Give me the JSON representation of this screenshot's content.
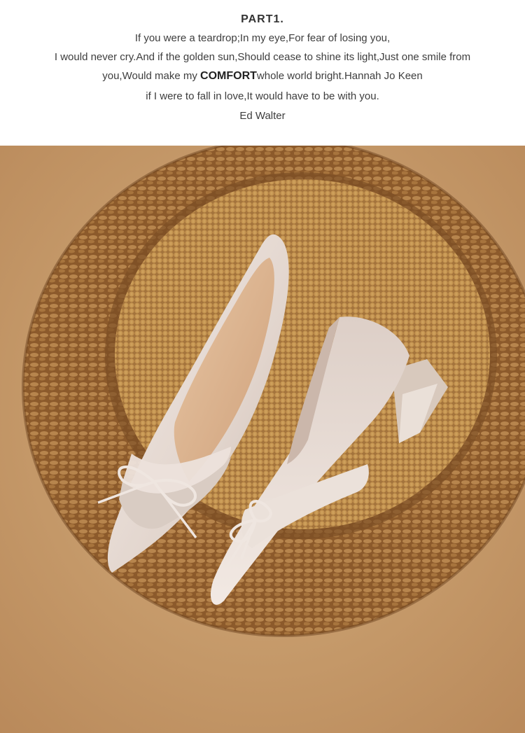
{
  "header": {
    "title": "PART1.",
    "line1": "If you were a teardrop;In my eye,For fear of losing you,",
    "line2": "I would never cry.And if the golden sun,Should cease to shine its light,Just one smile from",
    "line3_before": "you,Would make my ",
    "line3_emphasis": "COMFORT",
    "line3_after": "whole world bright.Hannah Jo Keen",
    "line4": "if I were to fall in love,It would have to be with you.",
    "line5": "Ed Walter"
  },
  "photo": {
    "subject": "product-photo",
    "colors": {
      "background": "#c9a06c",
      "mat_outer": "#8a5a2e",
      "mat_inner": "#c99a55",
      "satin": "#e6dad2",
      "lining": "#d9b48f"
    }
  }
}
